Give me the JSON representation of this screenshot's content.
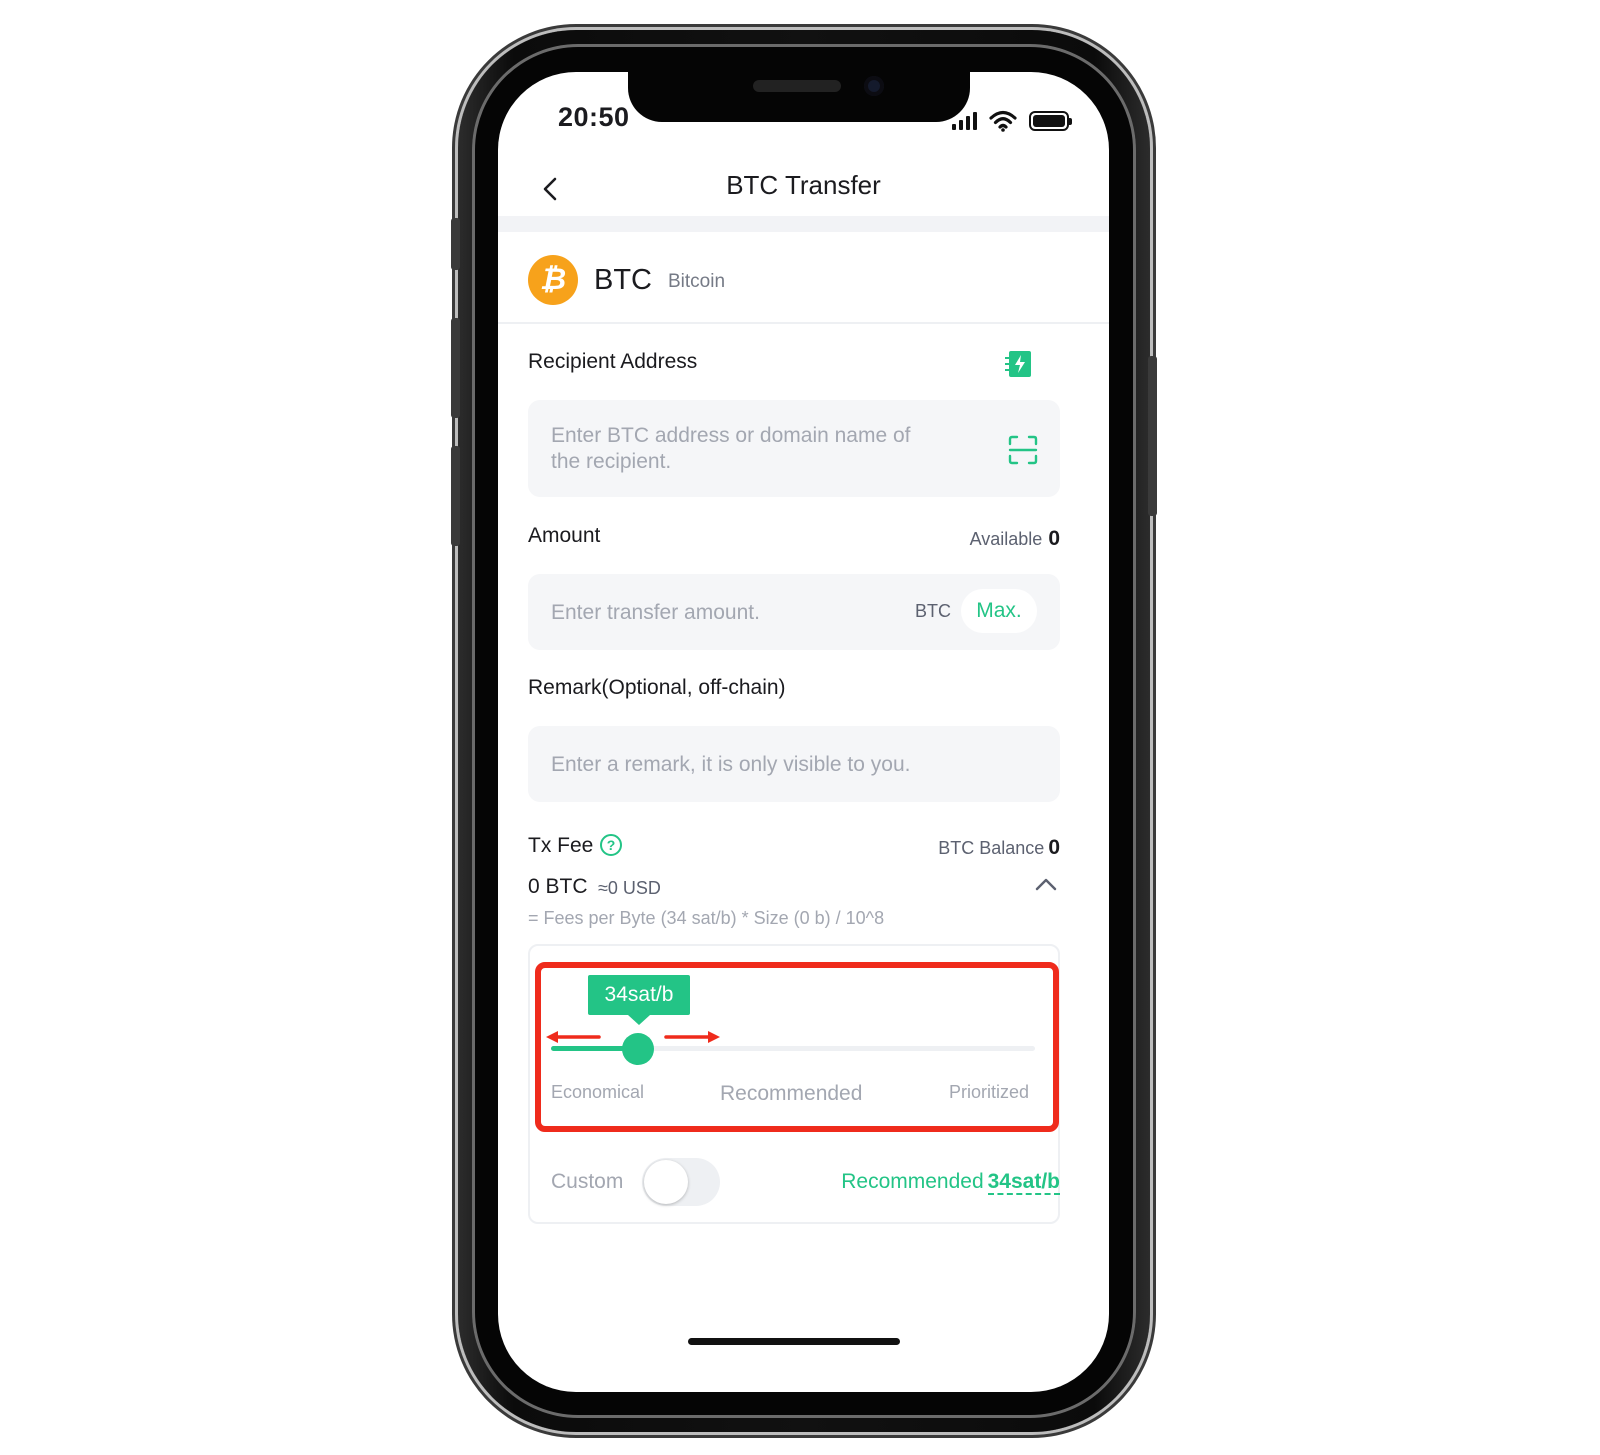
{
  "status_bar": {
    "time": "20:50"
  },
  "nav": {
    "title": "BTC Transfer"
  },
  "coin": {
    "symbol": "BTC",
    "name": "Bitcoin",
    "logo_glyph": "₿",
    "logo_color": "#f7a21b"
  },
  "recipient": {
    "label": "Recipient Address",
    "placeholder_line1": "Enter BTC address or domain name of",
    "placeholder_line2": "the recipient."
  },
  "amount": {
    "label": "Amount",
    "available_label": "Available",
    "available_value": "0",
    "placeholder": "Enter transfer amount.",
    "unit": "BTC",
    "max_label": "Max."
  },
  "remark": {
    "label": "Remark(Optional, off-chain)",
    "placeholder": "Enter a remark, it is only visible to you."
  },
  "tx_fee": {
    "label": "Tx Fee",
    "help_glyph": "?",
    "balance_label": "BTC Balance",
    "balance_value": "0",
    "amount": "0 BTC",
    "usd": "≈0 USD",
    "formula": "= Fees per Byte (34 sat/b) * Size (0 b)  / 10^8"
  },
  "fee_slider": {
    "tooltip": "34sat/b",
    "level_fraction": 0.18,
    "tiers": [
      "Economical",
      "Recommended",
      "Prioritized"
    ],
    "custom_label": "Custom",
    "custom_enabled": false,
    "recommended_label": "Recommended",
    "recommended_value": "34sat/b"
  },
  "colors": {
    "accent": "#23c486",
    "highlight": "#ef2b1c",
    "bitcoin": "#f7a21b"
  }
}
